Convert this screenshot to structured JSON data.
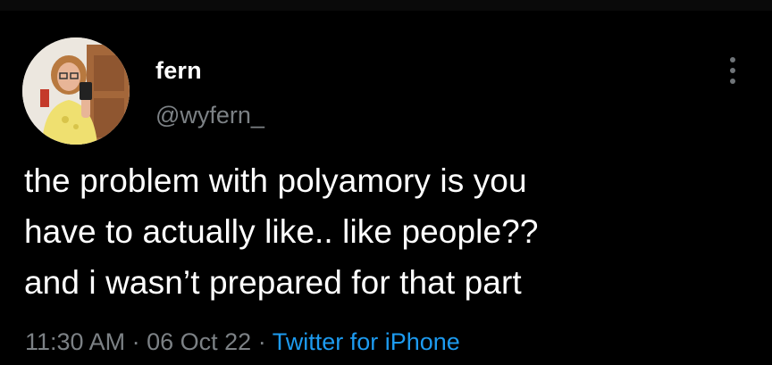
{
  "tweet": {
    "author": {
      "display_name": "fern",
      "handle": "@wyfern_"
    },
    "text_lines": [
      "the problem with polyamory is you",
      "have to actually like.. like people??",
      "and i wasn’t prepared for that part"
    ],
    "time": "11:30 AM",
    "date": "06 Oct 22",
    "separator": "·",
    "source": "Twitter for iPhone",
    "icons": {
      "more": "more-vertical-icon"
    }
  },
  "colors": {
    "background": "#000000",
    "text_primary": "#ffffff",
    "text_secondary": "#7c8185",
    "link": "#1d9bf0"
  }
}
